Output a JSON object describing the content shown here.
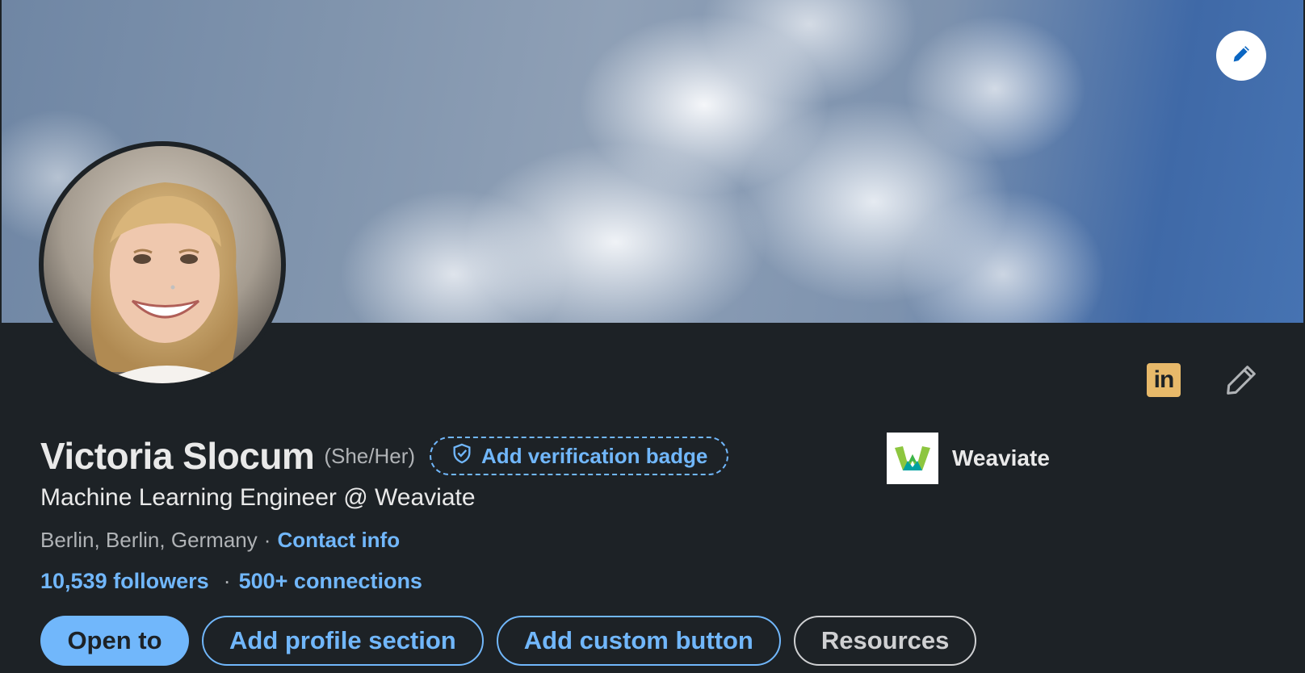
{
  "profile": {
    "name": "Victoria Slocum",
    "pronouns": "(She/Her)",
    "verification_label": "Add verification badge",
    "headline": "Machine Learning Engineer @ Weaviate",
    "location": "Berlin, Berlin, Germany",
    "location_separator": "·",
    "contact_label": "Contact info",
    "followers": "10,539 followers",
    "stats_separator": "·",
    "connections": "500+ connections"
  },
  "company": {
    "name": "Weaviate"
  },
  "top_icons": {
    "linkedin_text": "in"
  },
  "buttons": {
    "open_to": "Open to",
    "add_profile_section": "Add profile section",
    "add_custom_button": "Add custom button",
    "resources": "Resources"
  },
  "icons": {
    "banner_edit": "pencil-icon",
    "verify": "shield-check-icon",
    "linkedin": "linkedin-icon",
    "profile_edit": "pencil-outline-icon"
  },
  "colors": {
    "background": "#1d2226",
    "accent": "#71b7fb",
    "linkedin_badge": "#e7b96a",
    "text_primary": "#e9e9e9",
    "text_secondary": "#b0b3b6"
  }
}
